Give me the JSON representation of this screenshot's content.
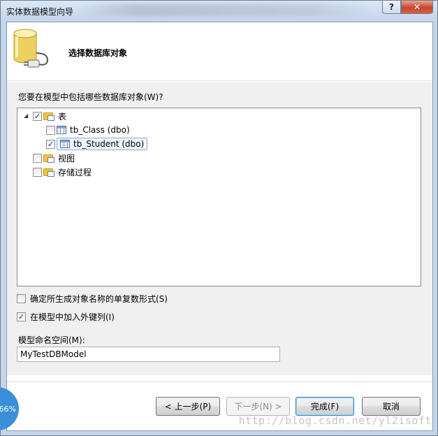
{
  "window": {
    "title": "实体数据模型向导",
    "help_glyph": "?",
    "close_glyph": "✕"
  },
  "header": {
    "title": "选择数据库对象"
  },
  "main": {
    "question": "您要在模型中包括哪些数据库对象(W)?",
    "tree": {
      "tables": {
        "label": "表",
        "expander": "◢",
        "checked": true
      },
      "table_items": [
        {
          "label": "tb_Class (dbo)",
          "checked": false
        },
        {
          "label": "tb_Student (dbo)",
          "checked": true
        }
      ],
      "views": {
        "label": "视图",
        "checked": false
      },
      "procedures": {
        "label": "存储过程",
        "checked": false
      }
    },
    "option_pluralize": {
      "label": "确定所生成对象名称的单复数形式(S)",
      "checked": false
    },
    "option_foreign_keys": {
      "label": "在模型中加入外键列(I)",
      "checked": true
    },
    "namespace": {
      "label": "模型命名空间(M):",
      "value": "MyTestDBModel"
    }
  },
  "footer": {
    "back_label": "< 上一步(P)",
    "next_label": "下一步(N) >",
    "finish_label": "完成(F)",
    "cancel_label": "取消"
  },
  "overlay": {
    "badge": "66%",
    "watermark": "http://blog.csdn.net/yl2isoft"
  },
  "colors": {
    "accent": "#3a8fd8",
    "close": "#c8452c",
    "selection": "#eef5fd"
  }
}
